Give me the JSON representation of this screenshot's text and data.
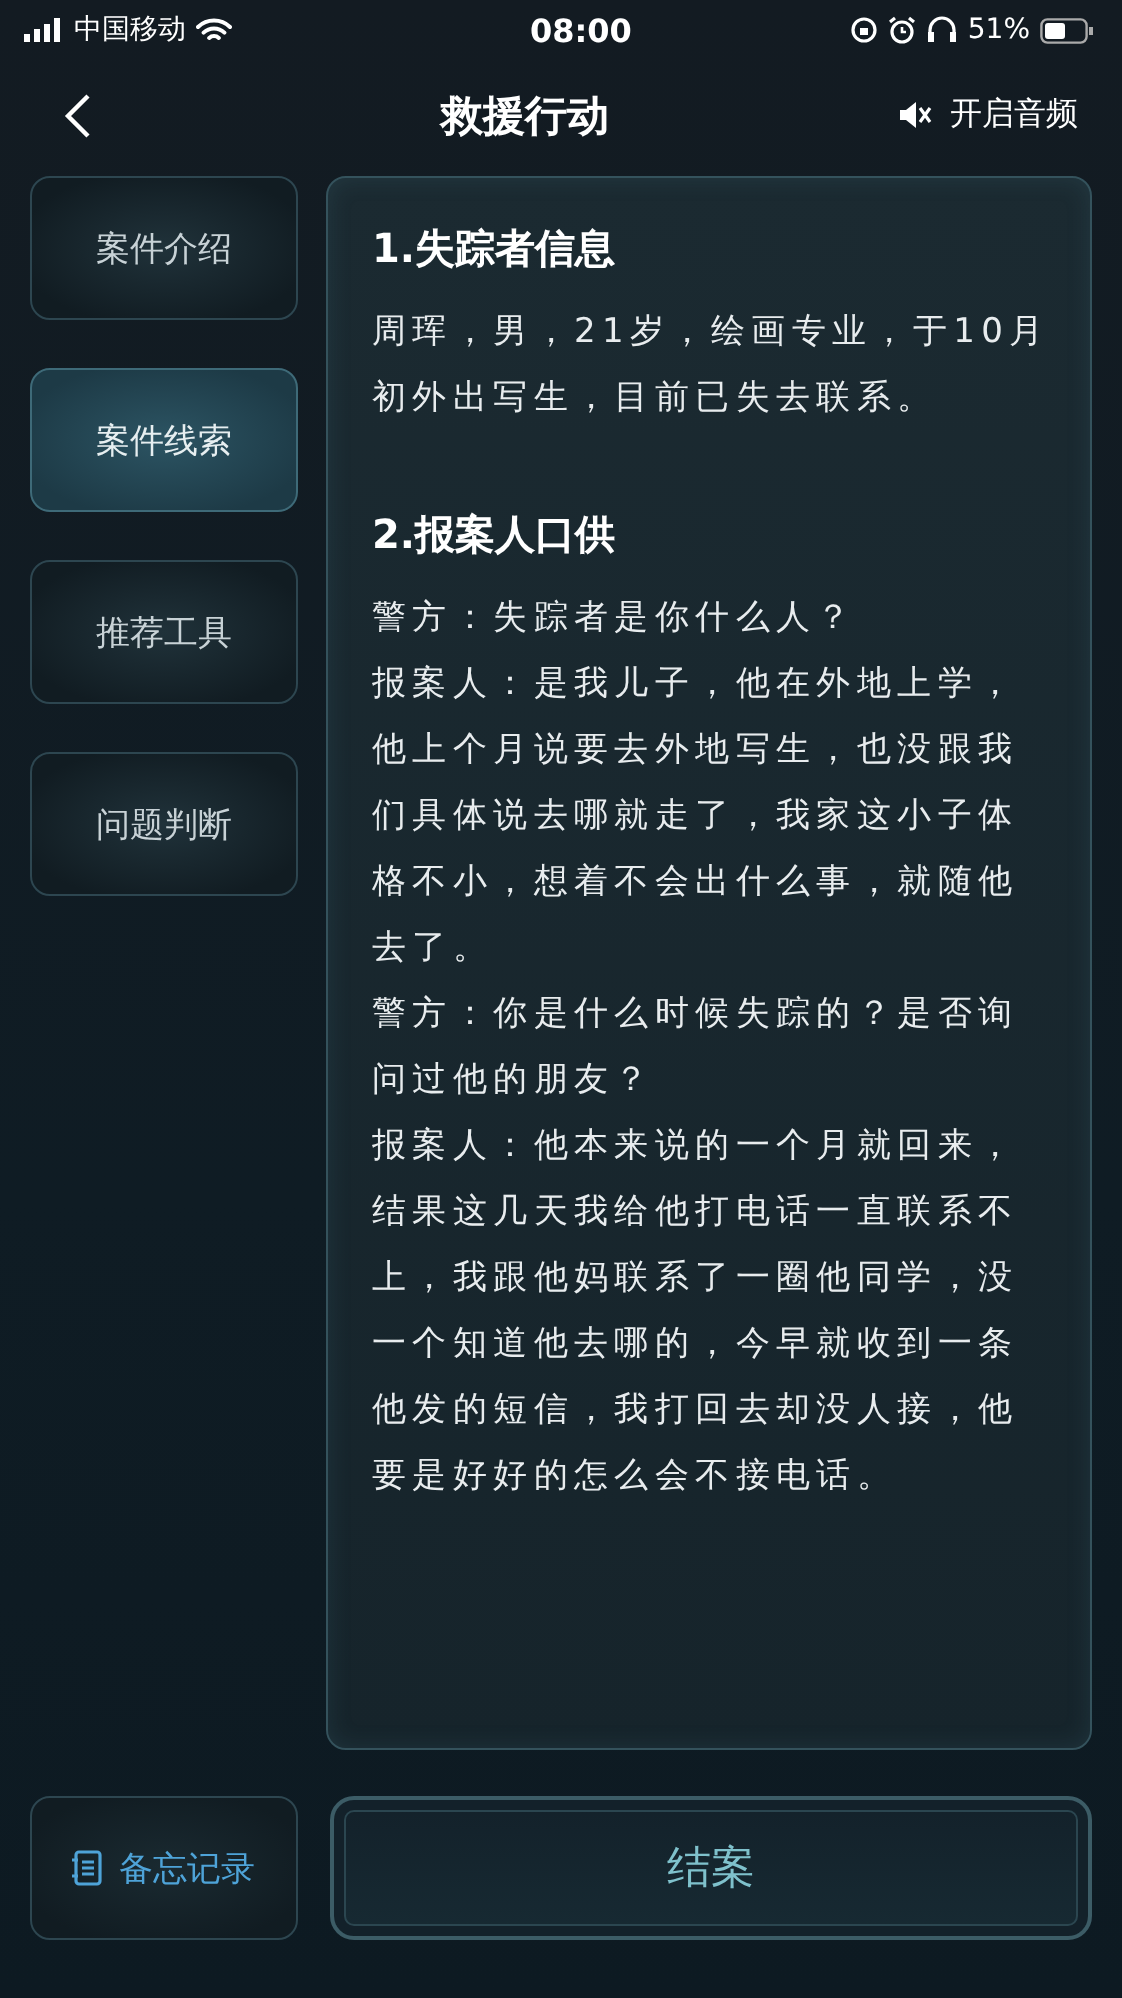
{
  "status_bar": {
    "carrier": "中国移动",
    "time": "08:00",
    "battery": "51%"
  },
  "header": {
    "title": "救援行动",
    "audio_toggle": "开启音频"
  },
  "sidebar": {
    "items": [
      {
        "label": "案件介绍",
        "selected": false
      },
      {
        "label": "案件线索",
        "selected": true
      },
      {
        "label": "推荐工具",
        "selected": false
      },
      {
        "label": "问题判断",
        "selected": false
      }
    ]
  },
  "content": {
    "sections": [
      {
        "heading": "1.失踪者信息",
        "paragraphs": [
          "周珲，男，21岁，绘画专业，于10月初外出写生，目前已失去联系。"
        ]
      },
      {
        "heading": "2.报案人口供",
        "paragraphs": [
          "警方：失踪者是你什么人？",
          "报案人：是我儿子，他在外地上学，他上个月说要去外地写生，也没跟我们具体说去哪就走了，我家这小子体格不小，想着不会出什么事，就随他去了。",
          "警方：你是什么时候失踪的？是否询问过他的朋友？",
          "报案人：他本来说的一个月就回来，结果这几天我给他打电话一直联系不上，我跟他妈联系了一圈他同学，没一个知道他去哪的，今早就收到一条他发的短信，我打回去却没人接，他要是好好的怎么会不接电话。"
        ]
      }
    ]
  },
  "footer": {
    "memo_button": "备忘记录",
    "close_button": "结案"
  }
}
